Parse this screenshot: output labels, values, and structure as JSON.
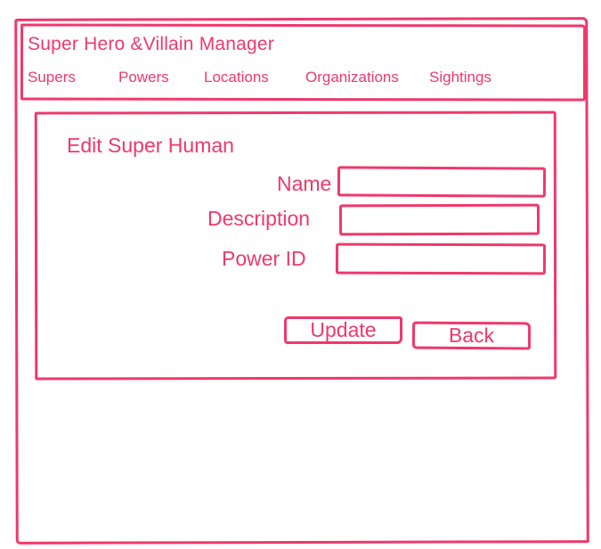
{
  "app": {
    "title": "Super Hero &Villain Manager"
  },
  "nav": {
    "items": [
      {
        "label": "Supers"
      },
      {
        "label": "Powers"
      },
      {
        "label": "Locations"
      },
      {
        "label": "Organizations"
      },
      {
        "label": "Sightings"
      }
    ]
  },
  "form": {
    "title": "Edit Super Human",
    "fields": [
      {
        "label": "Name",
        "value": "",
        "placeholder": ""
      },
      {
        "label": "Description",
        "value": "",
        "placeholder": ""
      },
      {
        "label": "Power ID",
        "value": "",
        "placeholder": ""
      }
    ],
    "update_label": "Update",
    "back_label": "Back"
  },
  "colors": {
    "accent": "#f0386b",
    "background": "#ffffff"
  }
}
